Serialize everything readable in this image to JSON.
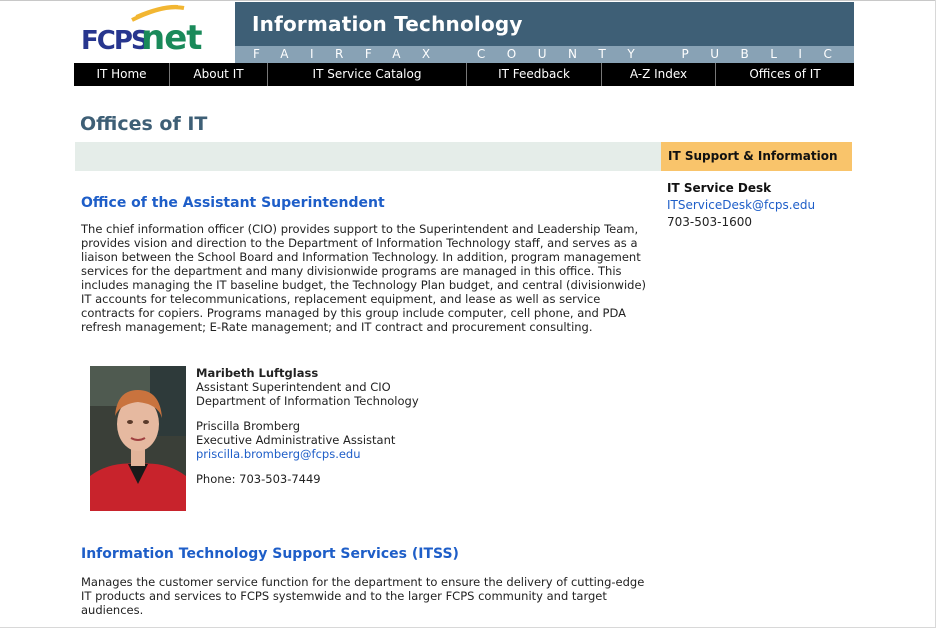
{
  "logo": {
    "text_a": "FCPS",
    "text_b": "net"
  },
  "banner": {
    "title": "Information Technology",
    "subtitle": "FAIRFAX COUNTY PUBLIC SCHOOLS"
  },
  "nav": [
    {
      "label": "IT Home"
    },
    {
      "label": "About IT"
    },
    {
      "label": "IT Service Catalog"
    },
    {
      "label": "IT Feedback"
    },
    {
      "label": "A-Z Index"
    },
    {
      "label": "Offices of IT"
    }
  ],
  "page_title": "Offices of IT",
  "sidebar": {
    "heading": "IT Support & Information",
    "desk_title": "IT Service Desk",
    "desk_email": "ITServiceDesk@fcps.edu",
    "desk_phone": "703-503-1600"
  },
  "section1": {
    "heading": "Office of the Assistant Superintendent",
    "body": "The chief information officer (CIO) provides support to the Superintendent and Leadership Team, provides vision and direction to the Department of Information Technology staff, and serves as a liaison between the School Board and Information Technology. In addition, program management services for the department and many divisionwide programs are managed in this office. This includes managing the IT baseline budget, the Technology Plan budget, and central (divisionwide) IT accounts for telecommunications, replacement equipment, and lease as well as service contracts for copiers. Programs managed by this group include computer, cell phone, and PDA refresh management; E-Rate management; and IT contract and procurement consulting.",
    "contact": {
      "name": "Maribeth Luftglass",
      "title_line1": "Assistant Superintendent and CIO",
      "title_line2": "Department of Information Technology",
      "assistant_name": "Priscilla Bromberg",
      "assistant_title": "Executive Administrative Assistant",
      "assistant_email": "priscilla.bromberg@fcps.edu",
      "phone": "Phone: 703-503-7449"
    }
  },
  "section2": {
    "heading": "Information Technology Support Services (ITSS)",
    "body": "Manages the customer service function for the department to ensure the delivery of cutting-edge IT products and services to FCPS systemwide and to the larger FCPS community and target audiences."
  },
  "colors": {
    "banner": "#3e5f76",
    "link": "#1e5ec8",
    "accent": "#f9c46b",
    "logo_green": "#1a8a5a",
    "logo_blue": "#27368e"
  }
}
